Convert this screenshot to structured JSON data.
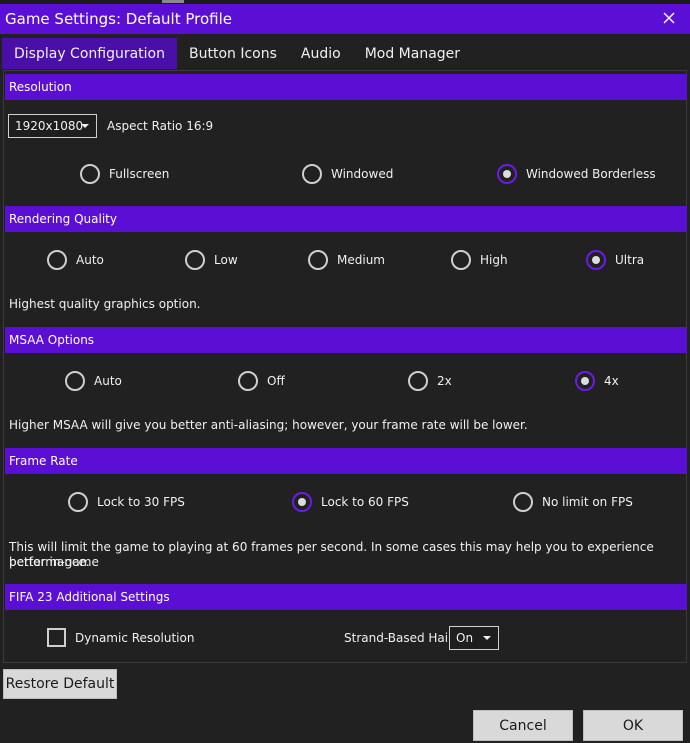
{
  "window": {
    "title": "Game Settings: Default Profile"
  },
  "tabs": [
    {
      "label": "Display Configuration",
      "active": true
    },
    {
      "label": "Button Icons",
      "active": false
    },
    {
      "label": "Audio",
      "active": false
    },
    {
      "label": "Mod Manager",
      "active": false
    }
  ],
  "resolution": {
    "header": "Resolution",
    "select_value": "1920x1080",
    "aspect_label": "Aspect Ratio 16:9",
    "modes": [
      "Fullscreen",
      "Windowed",
      "Windowed Borderless"
    ],
    "selected_mode": "Windowed Borderless"
  },
  "rendering": {
    "header": "Rendering Quality",
    "options": [
      "Auto",
      "Low",
      "Medium",
      "High",
      "Ultra"
    ],
    "selected": "Ultra",
    "description": "Highest quality graphics option."
  },
  "msaa": {
    "header": "MSAA Options",
    "options": [
      "Auto",
      "Off",
      "2x",
      "4x"
    ],
    "selected": "4x",
    "description": "Higher MSAA will give you better anti-aliasing; however, your frame rate will be lower."
  },
  "framerate": {
    "header": "Frame Rate",
    "options": [
      "Lock to 30 FPS",
      "Lock to 60 FPS",
      "No limit on FPS"
    ],
    "selected": "Lock to 60 FPS",
    "description_line1": "This will limit the game to playing at 60 frames per second. In some cases this may help you to experience better in-game",
    "description_line2": "performance."
  },
  "additional": {
    "header": "FIFA 23 Additional Settings",
    "dynamic_resolution_label": "Dynamic Resolution",
    "dynamic_resolution_checked": false,
    "hair_label": "Strand-Based Hair",
    "hair_value": "On"
  },
  "buttons": {
    "restore": "Restore Default",
    "cancel": "Cancel",
    "ok": "OK"
  },
  "colors": {
    "accent": "#5c0fd4",
    "tab_active": "#4a0fa8",
    "background": "#222121",
    "button": "#d9d9d9"
  },
  "icons": {
    "close": "close-icon",
    "dropdown": "chevron-down-icon"
  }
}
